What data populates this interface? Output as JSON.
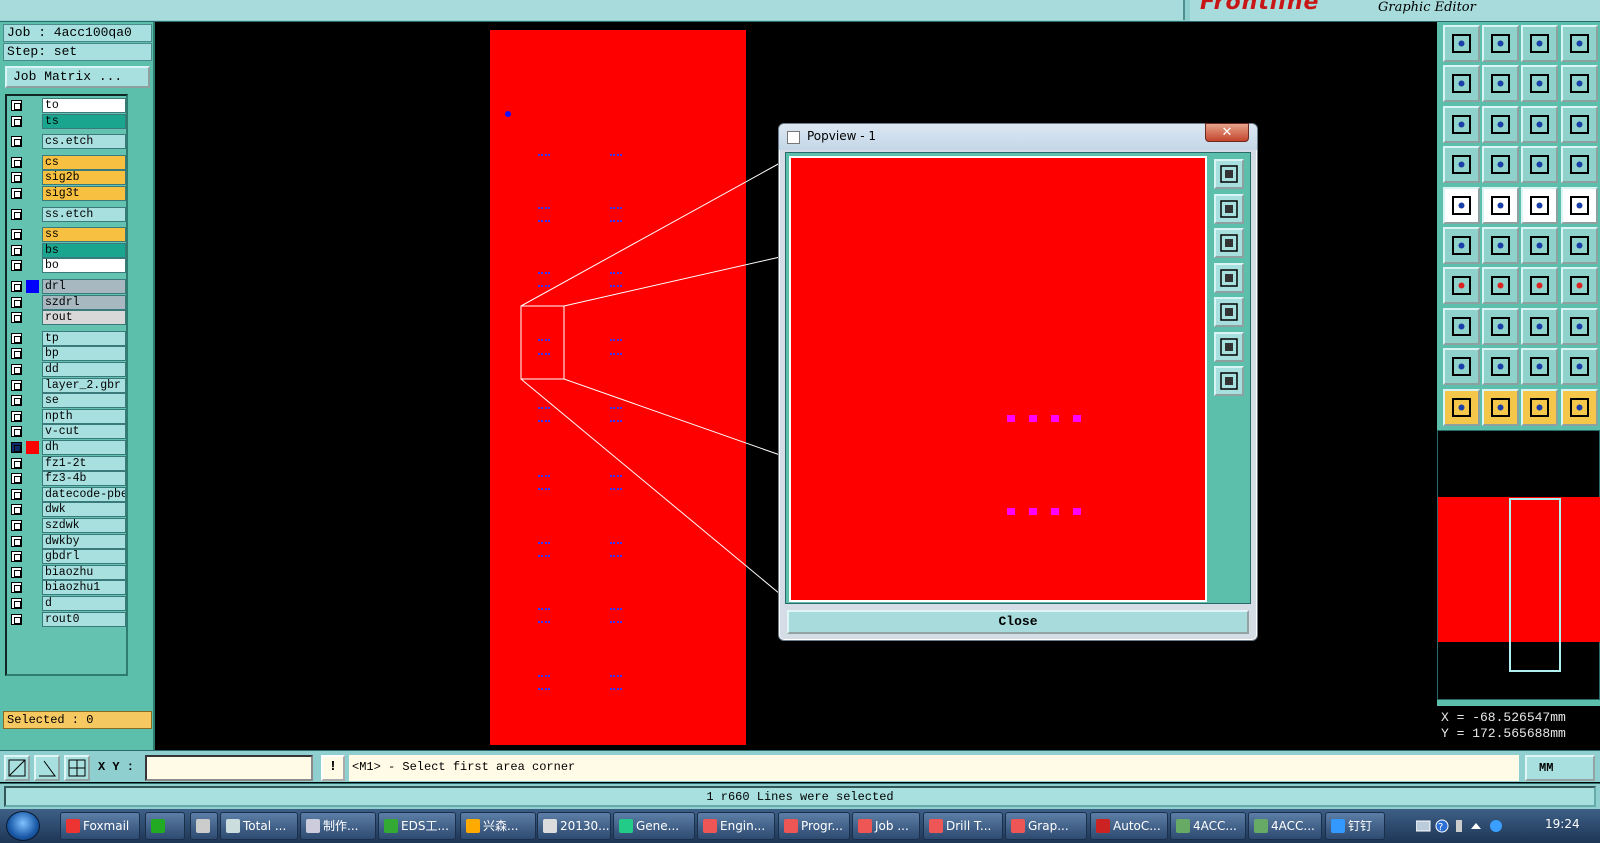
{
  "topbar": {
    "brand_logo": "Frontline",
    "brand_subtitle": "Graphic Editor"
  },
  "job": {
    "job_label": "Job : 4acc100qa0",
    "step_label": "Step: set",
    "matrix_button": "Job Matrix ..."
  },
  "layers": [
    {
      "name": "to",
      "color": "#ffffff",
      "swatch": "",
      "checked": false
    },
    {
      "name": "ts",
      "color": "#1aa58e",
      "swatch": "",
      "checked": false
    },
    {
      "name": "cs.etch",
      "color": "#a8e0e0",
      "swatch": "",
      "checked": false
    },
    {
      "name": "cs",
      "color": "#f7c040",
      "swatch": "",
      "checked": false
    },
    {
      "name": "sig2b",
      "color": "#f7c040",
      "swatch": "",
      "checked": false
    },
    {
      "name": "sig3t",
      "color": "#f7c040",
      "swatch": "",
      "checked": false
    },
    {
      "name": "ss.etch",
      "color": "#a8e0e0",
      "swatch": "",
      "checked": false
    },
    {
      "name": "ss",
      "color": "#f7c040",
      "swatch": "",
      "checked": false
    },
    {
      "name": "bs",
      "color": "#1aa58e",
      "swatch": "",
      "checked": false
    },
    {
      "name": "bo",
      "color": "#ffffff",
      "swatch": "",
      "checked": false
    },
    {
      "name": "drl",
      "color": "#a8b8c0",
      "swatch": "#0000ff",
      "checked": false
    },
    {
      "name": "szdrl",
      "color": "#a8b8c0",
      "swatch": "",
      "checked": false
    },
    {
      "name": "rout",
      "color": "#d8d8d8",
      "swatch": "",
      "checked": false
    },
    {
      "name": "tp",
      "color": "#a8e0e0",
      "swatch": "",
      "checked": false
    },
    {
      "name": "bp",
      "color": "#a8e0e0",
      "swatch": "",
      "checked": false
    },
    {
      "name": "dd",
      "color": "#a8e0e0",
      "swatch": "",
      "checked": false
    },
    {
      "name": "layer_2.gbr",
      "color": "#a8e0e0",
      "swatch": "",
      "checked": false
    },
    {
      "name": "se",
      "color": "#a8e0e0",
      "swatch": "",
      "checked": false
    },
    {
      "name": "npth",
      "color": "#a8e0e0",
      "swatch": "",
      "checked": false
    },
    {
      "name": "v-cut",
      "color": "#a8e0e0",
      "swatch": "",
      "checked": false
    },
    {
      "name": "dh",
      "color": "#a8e0e0",
      "swatch": "#ff0000",
      "checked": true
    },
    {
      "name": "fz1-2t",
      "color": "#a8e0e0",
      "swatch": "",
      "checked": false
    },
    {
      "name": "fz3-4b",
      "color": "#a8e0e0",
      "swatch": "",
      "checked": false
    },
    {
      "name": "datecode-pbe",
      "color": "#a8e0e0",
      "swatch": "",
      "checked": false
    },
    {
      "name": "dwk",
      "color": "#a8e0e0",
      "swatch": "",
      "checked": false
    },
    {
      "name": "szdwk",
      "color": "#a8e0e0",
      "swatch": "",
      "checked": false
    },
    {
      "name": "dwkby",
      "color": "#a8e0e0",
      "swatch": "",
      "checked": false
    },
    {
      "name": "gbdrl",
      "color": "#a8e0e0",
      "swatch": "",
      "checked": false
    },
    {
      "name": "biaozhu",
      "color": "#a8e0e0",
      "swatch": "",
      "checked": false
    },
    {
      "name": "biaozhu1",
      "color": "#a8e0e0",
      "swatch": "",
      "checked": false
    },
    {
      "name": "d",
      "color": "#a8e0e0",
      "swatch": "",
      "checked": false
    },
    {
      "name": "rout0",
      "color": "#a8e0e0",
      "swatch": "",
      "checked": false
    }
  ],
  "selection": {
    "selected_label": "Selected : 0"
  },
  "popview": {
    "title": "Popview - 1",
    "close_button": "Close",
    "close_x": "✕"
  },
  "coords": {
    "x": "X = -68.526547mm",
    "y": "Y = 172.565688mm"
  },
  "command": {
    "xy_label": "X Y :",
    "xy_value": "",
    "excl": "!",
    "prompt": "<M1> - Select first area corner",
    "units": "MM"
  },
  "status": {
    "message": "1 r660 Lines were selected"
  },
  "taskbar": {
    "items": [
      "Foxmail",
      "",
      "",
      "Total ...",
      "制作...",
      "EDS工...",
      "兴森...",
      "20130...",
      "Gene...",
      "Engin...",
      "Progr...",
      "Job ...",
      "Drill T...",
      "Grap...",
      "AutoC...",
      "4ACC...",
      "4ACC...",
      "钉钉"
    ],
    "clock": "19:24"
  },
  "colors": {
    "board_red": "#ff0000",
    "panel_teal": "#5cbfac",
    "highlight_yellow": "#f4c64a",
    "pad_magenta": "#ff00ff"
  }
}
